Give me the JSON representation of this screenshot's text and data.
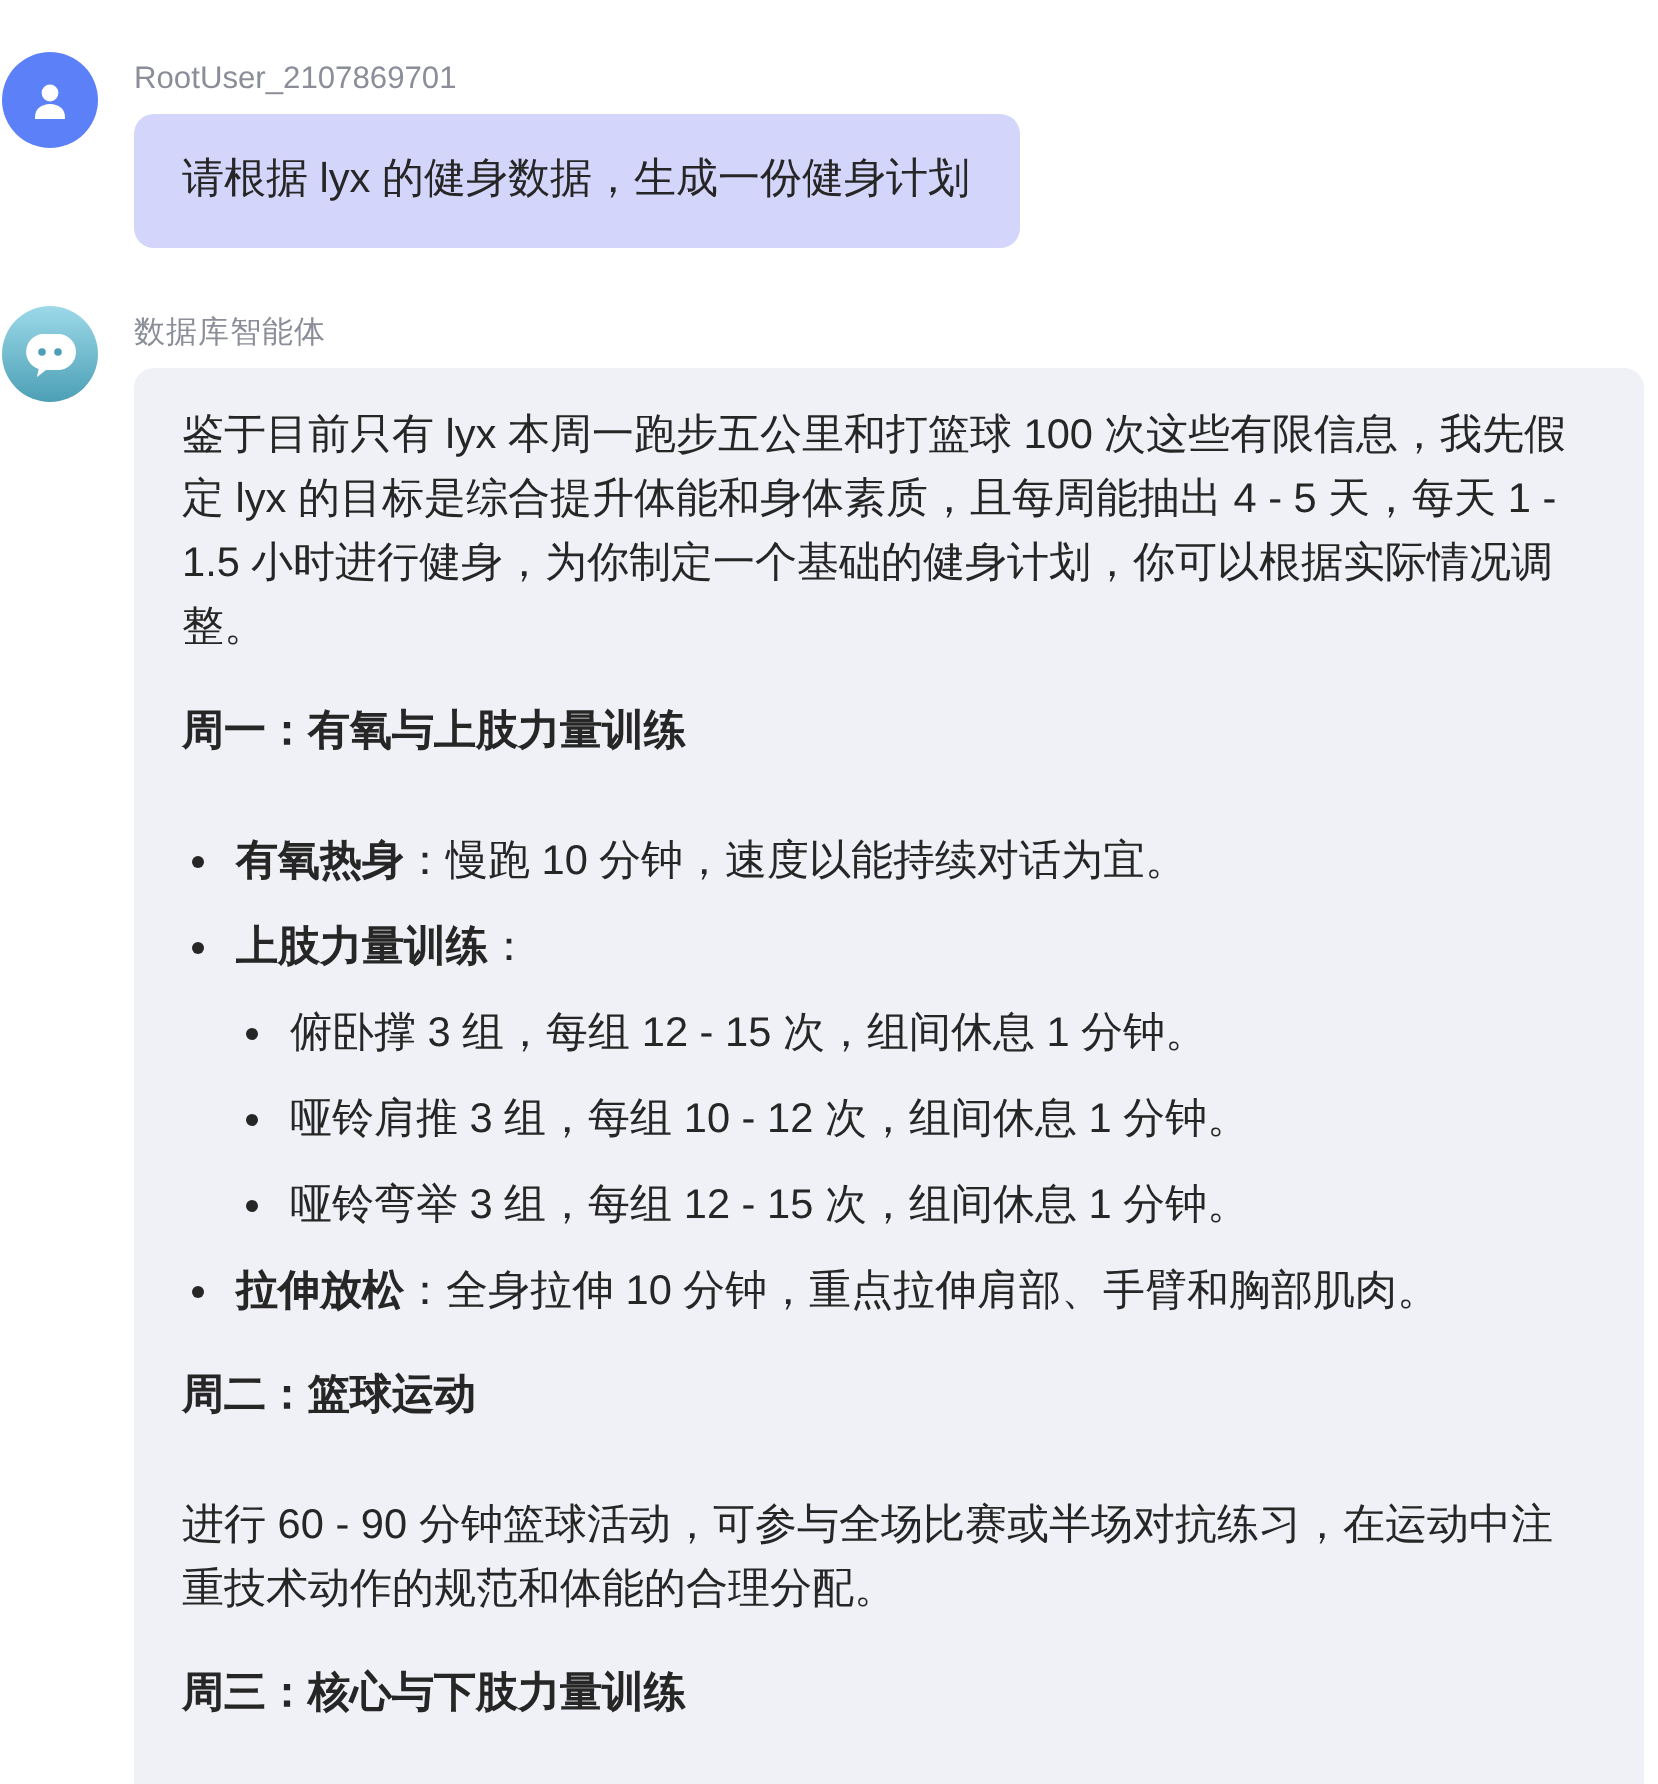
{
  "messages": [
    {
      "kind": "user",
      "sender": "RootUser_2107869701",
      "text": "请根据 lyx 的健身数据，生成一份健身计划"
    },
    {
      "kind": "assistant",
      "sender": "数据库智能体",
      "blocks": [
        {
          "kind": "paragraph",
          "text": "鉴于目前只有 lyx 本周一跑步五公里和打篮球 100 次这些有限信息，我先假定 lyx 的目标是综合提升体能和身体素质，且每周能抽出 4 - 5 天，每天 1 - 1.5 小时进行健身，为你制定一个基础的健身计划，你可以根据实际情况调整。"
        },
        {
          "kind": "heading",
          "text": "周一：有氧与上肢力量训练"
        },
        {
          "kind": "list",
          "items": [
            {
              "text": "**有氧热身**：慢跑 10 分钟，速度以能持续对话为宜。"
            },
            {
              "text": "**上肢力量训练**：",
              "children": [
                {
                  "text": "俯卧撑 3 组，每组 12 - 15 次，组间休息 1 分钟。"
                },
                {
                  "text": "哑铃肩推 3 组，每组 10 - 12 次，组间休息 1 分钟。"
                },
                {
                  "text": "哑铃弯举 3 组，每组 12 - 15 次，组间休息 1 分钟。"
                }
              ]
            },
            {
              "text": "**拉伸放松**：全身拉伸 10 分钟，重点拉伸肩部、手臂和胸部肌肉。"
            }
          ]
        },
        {
          "kind": "heading",
          "text": "周二：篮球运动"
        },
        {
          "kind": "paragraph",
          "text": "进行 60 - 90 分钟篮球活动，可参与全场比赛或半场对抗练习，在运动中注重技术动作的规范和体能的合理分配。"
        },
        {
          "kind": "heading",
          "text": "周三：核心与下肢力量训练"
        }
      ]
    }
  ]
}
